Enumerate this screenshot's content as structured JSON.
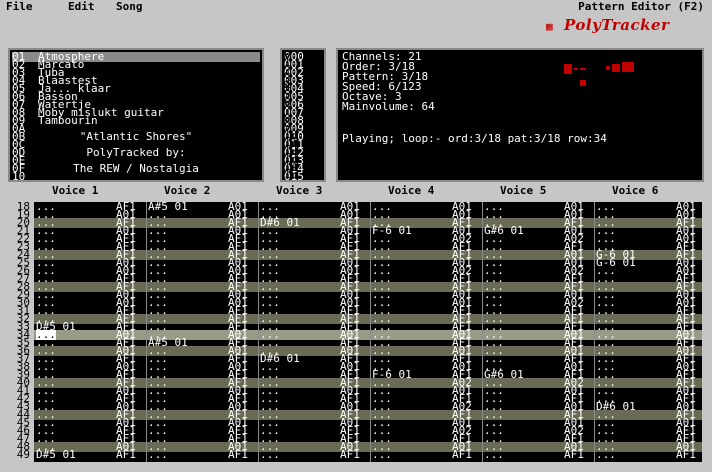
{
  "menu": {
    "file": "File",
    "edit": "Edit",
    "song": "Song"
  },
  "app_title": "Pattern Editor (F2)",
  "logo_text": "PolyTracker",
  "instruments": [
    {
      "num": "01",
      "name": "Atmosphere"
    },
    {
      "num": "02",
      "name": "Marcato"
    },
    {
      "num": "03",
      "name": "Tuba"
    },
    {
      "num": "04",
      "name": "Blaastest"
    },
    {
      "num": "05",
      "name": "Ja... klaar"
    },
    {
      "num": "06",
      "name": "Basson"
    },
    {
      "num": "07",
      "name": "Watertje"
    },
    {
      "num": "08",
      "name": "Moby mislukt guitar"
    },
    {
      "num": "09",
      "name": "Tambourin"
    },
    {
      "num": "0A",
      "name": ""
    },
    {
      "num": "0B",
      "name": "\"Atlantic Shores\""
    },
    {
      "num": "0C",
      "name": ""
    },
    {
      "num": "0D",
      "name": "PolyTracked by:"
    },
    {
      "num": "0E",
      "name": ""
    },
    {
      "num": "0F",
      "name": "The REW / Nostalgia"
    },
    {
      "num": "10",
      "name": ""
    }
  ],
  "order_left": [
    "0",
    "1",
    "2",
    "3",
    "4",
    "5",
    "6",
    "7",
    "8",
    "9",
    "10",
    "11",
    "12",
    "13",
    "14",
    "15"
  ],
  "order_values": [
    "000",
    "001",
    "002",
    "003",
    "004",
    "005",
    "006",
    "007",
    "008",
    "009",
    "010",
    "011",
    "012",
    "013",
    "014",
    "015"
  ],
  "info": {
    "channels": "Channels: 21",
    "order": "Order: 3/18",
    "pattern": "Pattern: 3/18",
    "speed": "Speed: 6/123",
    "octave": "Octave: 3",
    "mainvolume": "Mainvolume: 64",
    "playing": "Playing; loop:- ord:3/18 pat:3/18 row:34"
  },
  "voices": [
    "Voice 1",
    "Voice 2",
    "Voice 3",
    "Voice 4",
    "Voice 5",
    "Voice 6"
  ],
  "row_numbers": [
    "18",
    "19",
    "20",
    "21",
    "22",
    "23",
    "24",
    "25",
    "26",
    "27",
    "28",
    "29",
    "30",
    "31",
    "32",
    "33",
    "34",
    "35",
    "36",
    "37",
    "38",
    "39",
    "40",
    "41",
    "42",
    "43",
    "44",
    "45",
    "46",
    "47",
    "48",
    "49"
  ],
  "pattern_rows": [
    [
      "...",
      "AF1",
      "A#5 01",
      "A01",
      "...",
      "A01",
      "...",
      "A01",
      "...",
      "A01",
      "...",
      "A01"
    ],
    [
      "...",
      "A01",
      "...",
      "A01",
      "...",
      "A01",
      "...",
      "A01",
      "...",
      "A01",
      "...",
      "A01"
    ],
    [
      "...",
      "AF1",
      "...",
      "AF1",
      "D#6 01",
      "AF1",
      "...",
      "AF1",
      "...",
      "AF1",
      "...",
      "AF1"
    ],
    [
      "...",
      "A01",
      "...",
      "A01",
      "...",
      "A01",
      "F-6 01",
      "A01",
      "G#6 01",
      "A01",
      "...",
      "A01"
    ],
    [
      "...",
      "AF1",
      "...",
      "AF1",
      "...",
      "AF1",
      "...",
      "A02",
      "...",
      "A02",
      "...",
      "A01"
    ],
    [
      "...",
      "AF1",
      "...",
      "AF1",
      "...",
      "AF1",
      "...",
      "AF1",
      "...",
      "AF1",
      "...",
      "AF1"
    ],
    [
      "...",
      "AF1",
      "...",
      "AF1",
      "...",
      "AF1",
      "...",
      "AF1",
      "...",
      "A01",
      "G-6 01",
      "AF1"
    ],
    [
      "...",
      "A01",
      "...",
      "A01",
      "...",
      "A01",
      "...",
      "A01",
      "...",
      "A01",
      "G-6 01",
      "A01"
    ],
    [
      "...",
      "A01",
      "...",
      "A01",
      "...",
      "A01",
      "...",
      "A02",
      "...",
      "A02",
      "...",
      "A01"
    ],
    [
      "...",
      "AF1",
      "...",
      "AF1",
      "...",
      "AF1",
      "...",
      "AF1",
      "...",
      "AF1",
      "...",
      "AF1"
    ],
    [
      "...",
      "AF1",
      "...",
      "AF1",
      "...",
      "AF1",
      "...",
      "AF1",
      "...",
      "AF1",
      "...",
      "AF1"
    ],
    [
      "...",
      "A01",
      "...",
      "A01",
      "...",
      "A01",
      "...",
      "A01",
      "...",
      "A01",
      "...",
      "A01"
    ],
    [
      "...",
      "A01",
      "...",
      "A01",
      "...",
      "A01",
      "...",
      "A01",
      "...",
      "A02",
      "...",
      "A01"
    ],
    [
      "...",
      "AF1",
      "...",
      "AF1",
      "...",
      "AF1",
      "...",
      "AF1",
      "...",
      "AF1",
      "...",
      "AF1"
    ],
    [
      "...",
      "AF1",
      "...",
      "AF1",
      "...",
      "AF1",
      "...",
      "AF1",
      "...",
      "AF1",
      "...",
      "AF1"
    ],
    [
      "D#5 01",
      "AF1",
      "...",
      "AF1",
      "...",
      "AF1",
      "...",
      "AF1",
      "...",
      "AF1",
      "...",
      "AF1"
    ],
    [
      "...",
      "A01",
      "...",
      "A01",
      "...",
      "A01",
      "...",
      "A01",
      "...",
      "A01",
      "...",
      "A01"
    ],
    [
      "...",
      "AF1",
      "A#5 01",
      "AF1",
      "...",
      "AF1",
      "...",
      "AF1",
      "...",
      "AF1",
      "...",
      "AF1"
    ],
    [
      "...",
      "A01",
      "...",
      "A01",
      "...",
      "A01",
      "...",
      "A01",
      "...",
      "A01",
      "...",
      "A01"
    ],
    [
      "...",
      "AF1",
      "...",
      "AF1",
      "D#6 01",
      "AF1",
      "...",
      "AF1",
      "...",
      "AF1",
      "...",
      "AF1"
    ],
    [
      "...",
      "A01",
      "...",
      "A01",
      "...",
      "A01",
      "...",
      "A01",
      "...",
      "A01",
      "...",
      "A01"
    ],
    [
      "...",
      "AF1",
      "...",
      "AF1",
      "...",
      "AF1",
      "F-6 01",
      "AF1",
      "G#6 01",
      "AF1",
      "...",
      "AF1"
    ],
    [
      "...",
      "AF1",
      "...",
      "AF1",
      "...",
      "AF1",
      "...",
      "A02",
      "...",
      "A02",
      "...",
      "AF1"
    ],
    [
      "...",
      "A01",
      "...",
      "A01",
      "...",
      "A01",
      "...",
      "A01",
      "...",
      "A01",
      "...",
      "A01"
    ],
    [
      "...",
      "AF1",
      "...",
      "AF1",
      "...",
      "AF1",
      "...",
      "AF1",
      "...",
      "AF1",
      "...",
      "AF1"
    ],
    [
      "...",
      "A01",
      "...",
      "A01",
      "...",
      "A01",
      "...",
      "A02",
      "...",
      "A01",
      "D#6 01",
      "A01"
    ],
    [
      "...",
      "AF1",
      "...",
      "AF1",
      "...",
      "AF1",
      "...",
      "AF1",
      "...",
      "AF1",
      "...",
      "AF1"
    ],
    [
      "...",
      "A01",
      "...",
      "A01",
      "...",
      "A01",
      "...",
      "A01",
      "...",
      "A01",
      "...",
      "A01"
    ],
    [
      "...",
      "AF1",
      "...",
      "AF1",
      "...",
      "AF1",
      "...",
      "A02",
      "...",
      "A02",
      "...",
      "AF1"
    ],
    [
      "...",
      "AF1",
      "...",
      "AF1",
      "...",
      "AF1",
      "...",
      "AF1",
      "...",
      "AF1",
      "...",
      "AF1"
    ],
    [
      "...",
      "A01",
      "...",
      "A01",
      "...",
      "A01",
      "...",
      "A01",
      "...",
      "A01",
      "...",
      "A01"
    ],
    [
      "D#5 01",
      "AF1",
      "...",
      "AF1",
      "...",
      "AF1",
      "...",
      "AF1",
      "...",
      "AF1",
      "...",
      "AF1"
    ]
  ],
  "colors": {
    "accent": "#c00000",
    "panel_border": "#8a8a8a",
    "alt_row": "#6a6a55"
  }
}
